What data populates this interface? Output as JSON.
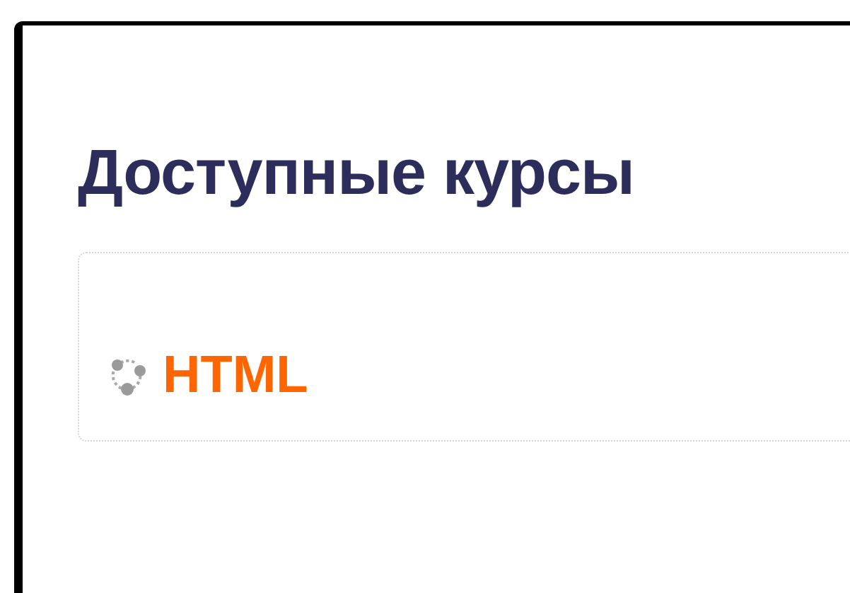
{
  "heading": "Доступные курсы",
  "courses": [
    {
      "name": "HTML"
    }
  ]
}
